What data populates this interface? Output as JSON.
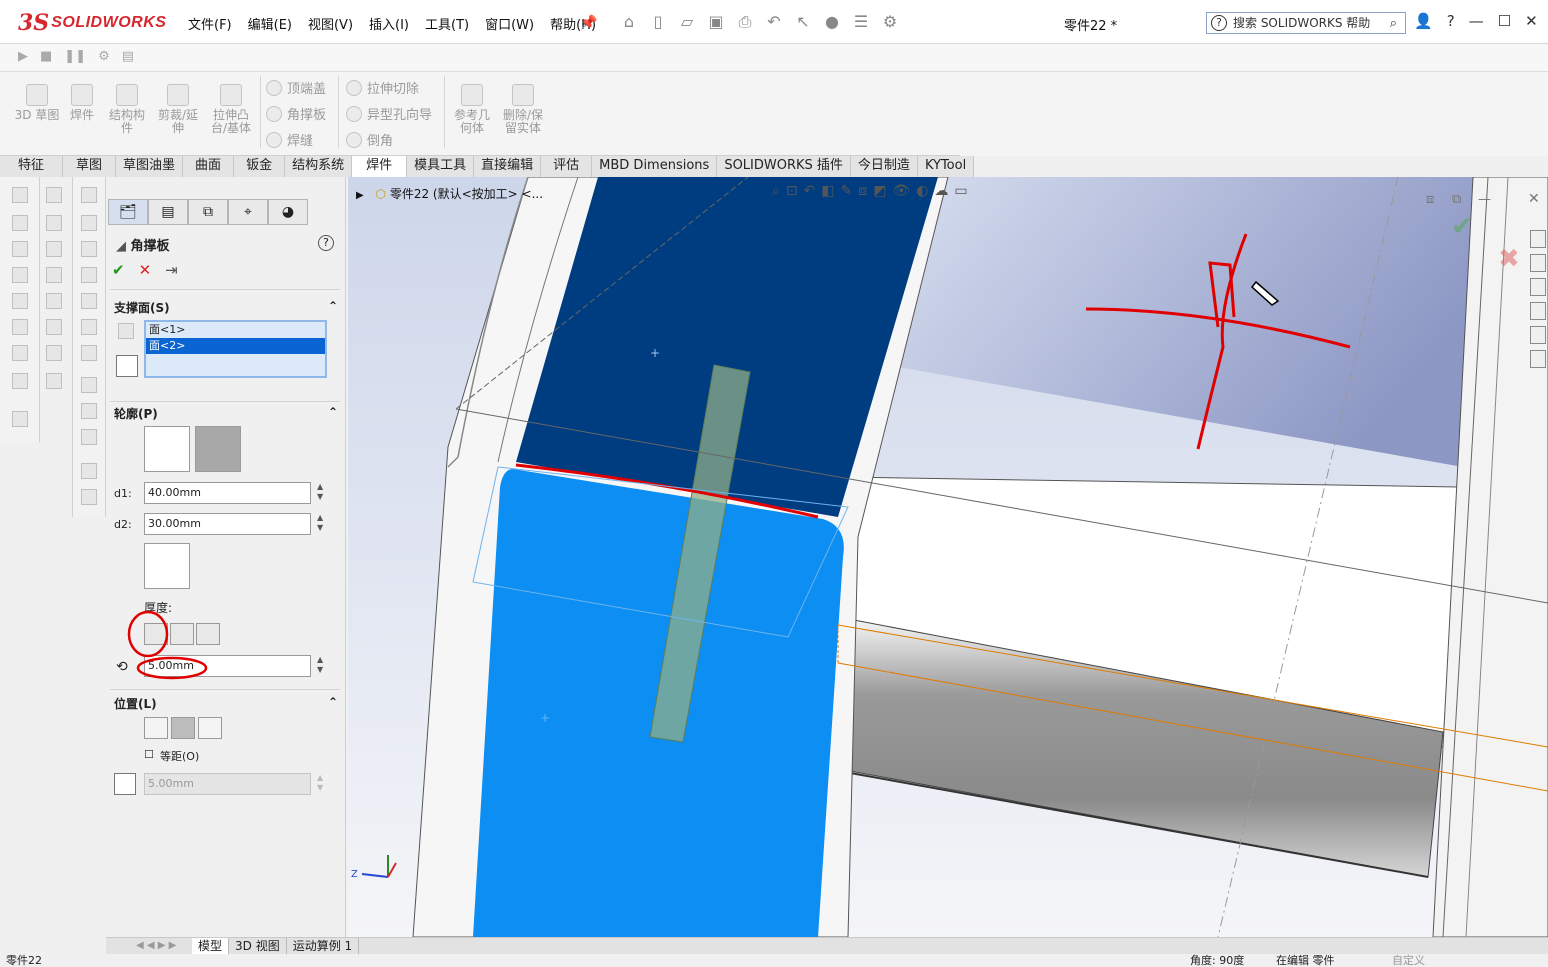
{
  "app": {
    "logo_ds": "3S",
    "logo_text": "SOLIDWORKS",
    "menus": [
      "文件(F)",
      "编辑(E)",
      "视图(V)",
      "插入(I)",
      "工具(T)",
      "窗口(W)",
      "帮助(H)"
    ],
    "document_title": "零件22 *",
    "search_placeholder": "搜索 SOLIDWORKS 帮助",
    "help_glyph": "?",
    "window_buttons": [
      "?",
      "—",
      "☐",
      "✕"
    ]
  },
  "command_manager": {
    "sketch3d": "3D 草图",
    "weldment": "焊件",
    "structure_member": "结构构件",
    "trim_extend": "剪裁/延伸",
    "extrude_boss": "拉伸凸台/基体",
    "end_cap": "顶端盖",
    "gusset": "角撑板",
    "weld_bead": "焊缝",
    "extrude_cut": "拉伸切除",
    "hole_wizard": "异型孔向导",
    "chamfer": "倒角",
    "ref_geometry": "参考几何体",
    "delete_keep_body": "删除/保留实体"
  },
  "tabs": [
    {
      "label": "特征",
      "active": false
    },
    {
      "label": "草图",
      "active": false
    },
    {
      "label": "草图油墨",
      "active": false
    },
    {
      "label": "曲面",
      "active": false
    },
    {
      "label": "钣金",
      "active": false
    },
    {
      "label": "结构系统",
      "active": false
    },
    {
      "label": "焊件",
      "active": true
    },
    {
      "label": "模具工具",
      "active": false
    },
    {
      "label": "直接编辑",
      "active": false
    },
    {
      "label": "评估",
      "active": false
    },
    {
      "label": "MBD Dimensions",
      "active": false
    },
    {
      "label": "SOLIDWORKS 插件",
      "active": false
    },
    {
      "label": "今日制造",
      "active": false
    },
    {
      "label": "KYTool",
      "active": false
    }
  ],
  "property_manager": {
    "title": "角撑板",
    "help": "?",
    "ok_glyph": "✔",
    "cancel_glyph": "✕",
    "pin_glyph": "⇥",
    "support_faces": {
      "label": "支撑面(S)",
      "faces": [
        "面<1>",
        "面<2>"
      ],
      "selected_index": 1
    },
    "profile": {
      "label": "轮廓(P)",
      "d1_label": "d1:",
      "d1_value": "40.00mm",
      "d2_label": "d2:",
      "d2_value": "30.00mm"
    },
    "thickness": {
      "label": "厚度:",
      "value": "5.00mm"
    },
    "location": {
      "label": "位置(L)",
      "offset_label": "等距(O)",
      "offset_checked": false,
      "offset_value": "5.00mm"
    }
  },
  "viewport": {
    "breadcrumb": "零件22 (默认<按加工> <...",
    "triad_z": "Z"
  },
  "bottom_tabs": [
    "模型",
    "3D 视图",
    "运动算例 1"
  ],
  "status": {
    "left": "零件22",
    "angle": "角度: 90度",
    "mode": "在编辑 零件",
    "custom": "自定义"
  },
  "colors": {
    "face_selected": "#0c8ef2",
    "face_dark": "#003d80",
    "annotation_red": "#e00000",
    "gusset_preview": "#8fae8a"
  }
}
